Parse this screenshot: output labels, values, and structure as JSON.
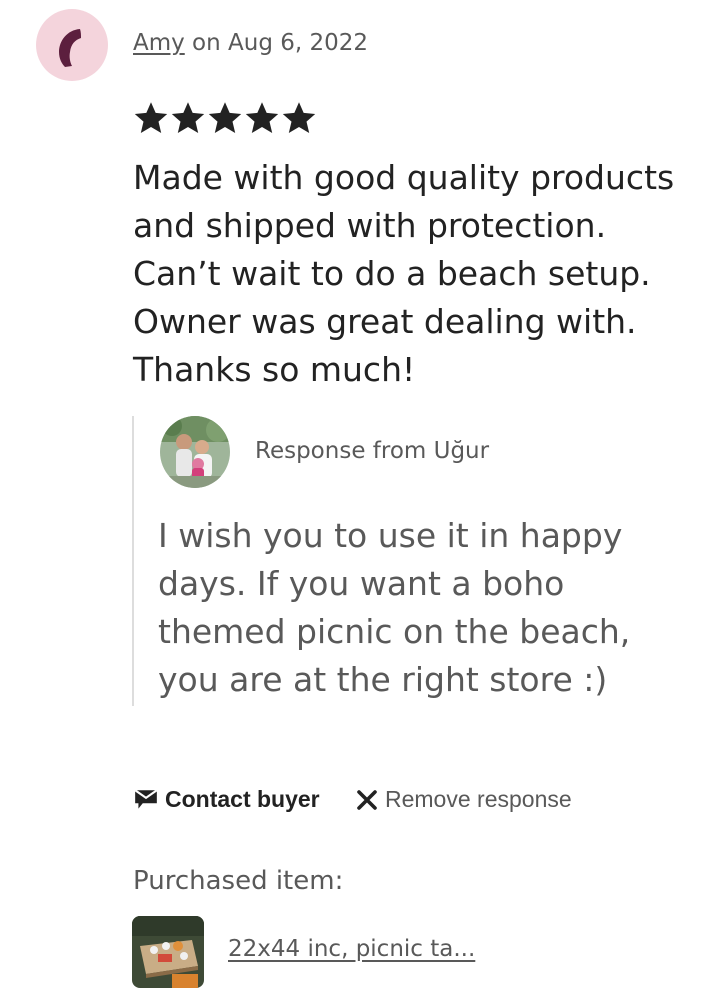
{
  "review": {
    "reviewer_name": "Amy",
    "date_prefix": " on ",
    "date": "Aug 6, 2022",
    "rating": 5,
    "rating_max": 5,
    "text": "Made with good quality products and shipped with protection. Can’t wait to do a beach setup. Owner was great dealing with. Thanks so much!"
  },
  "response": {
    "heading": "Response from Uğur",
    "text": "I wish you to use it in happy days. If you want a boho themed picnic on the beach, you are at the right store :)"
  },
  "actions": {
    "contact_label": "Contact buyer",
    "remove_label": "Remove response"
  },
  "purchase": {
    "label": "Purchased item:",
    "item_title": "22x44 inc, picnic ta..."
  },
  "colors": {
    "reviewer_avatar_bg": "#f4d4dc",
    "reviewer_avatar_glyph": "#5c1f3e",
    "text_primary": "#222222",
    "text_secondary": "#595959"
  },
  "icons": {
    "star": "star-icon",
    "contact": "message-icon",
    "remove": "close-icon"
  }
}
